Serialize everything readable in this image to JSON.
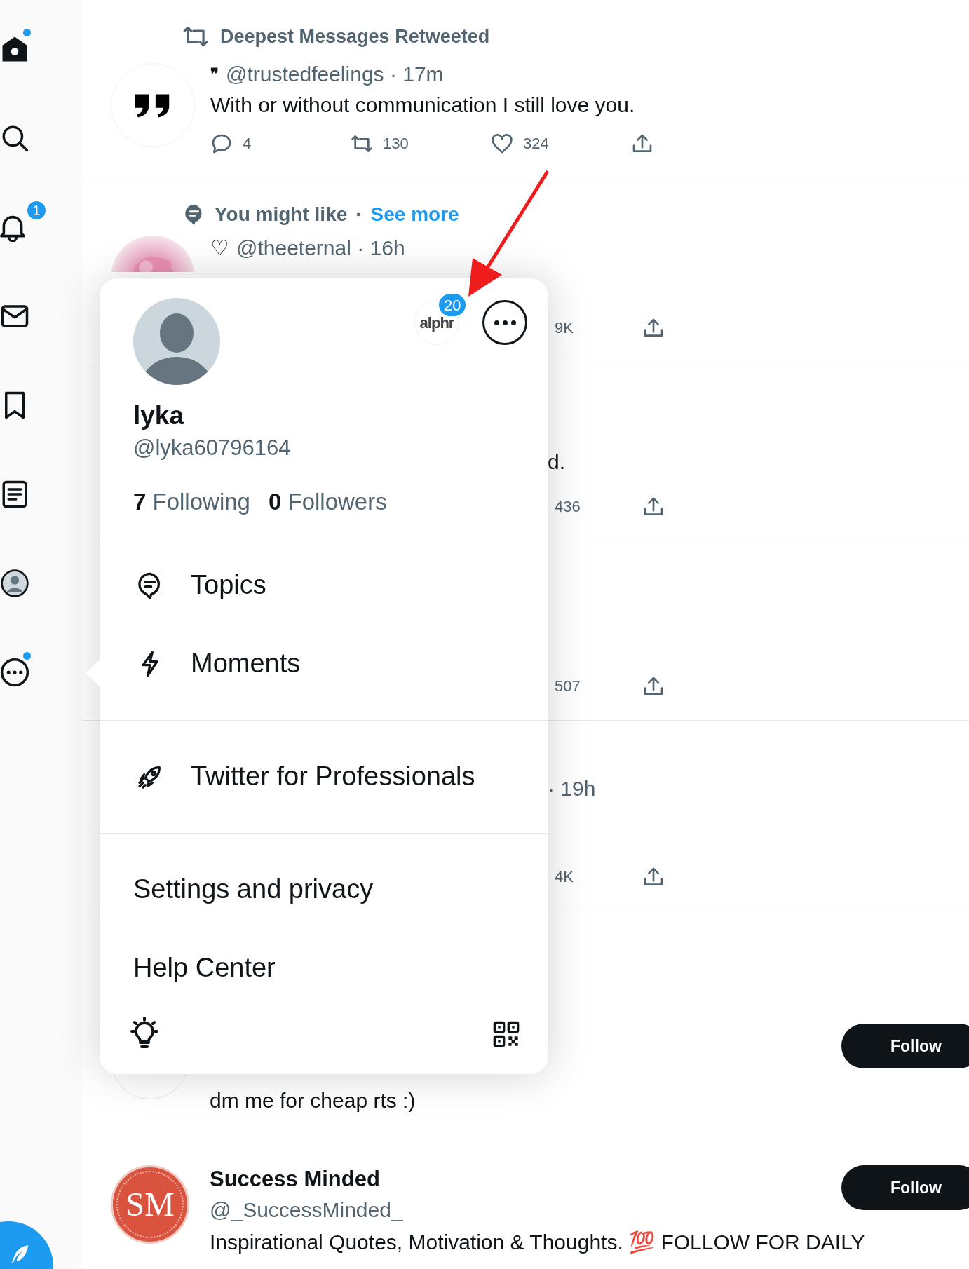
{
  "sidebar": {
    "items": [
      {
        "kind": "home",
        "unread_dot": true
      },
      {
        "kind": "search",
        "unread_dot": false
      },
      {
        "kind": "notifications",
        "unread_dot": false,
        "badge": "1"
      },
      {
        "kind": "messages",
        "unread_dot": false
      },
      {
        "kind": "bookmarks",
        "unread_dot": false
      },
      {
        "kind": "lists",
        "unread_dot": false
      },
      {
        "kind": "profile",
        "unread_dot": false
      },
      {
        "kind": "more",
        "unread_dot": true
      }
    ]
  },
  "feed": {
    "retweeted_tweet": {
      "context": "Deepest Messages Retweeted",
      "name_symbol": "❞",
      "handle": "@trustedfeelings · 17m",
      "text": "With or without communication I still love you.",
      "actions": [
        {
          "kind": "reply",
          "count": "4"
        },
        {
          "kind": "retweet",
          "count": "130"
        },
        {
          "kind": "like",
          "count": "324"
        },
        {
          "kind": "share"
        }
      ]
    },
    "suggested_tweet": {
      "context": "You might like",
      "separator": "·",
      "link": "See more",
      "name_symbol": "♡",
      "handle": "@theeternal · 16h",
      "count": "9K"
    },
    "covered_tweets": [
      {
        "text": "d.",
        "count": "436"
      },
      {
        "count": "507"
      },
      {
        "text": "· 19h",
        "count": "4K"
      }
    ],
    "accounts": [
      {
        "bio": "dm me for cheap rts :)",
        "follow": "Follow"
      },
      {
        "name": "Success Minded",
        "handle": "@_SuccessMinded_",
        "avatar": "SM",
        "bio": "Inspirational Quotes, Motivation & Thoughts. 💯 FOLLOW FOR DAILY",
        "follow": "Follow"
      }
    ]
  },
  "account_menu": {
    "name": "lyka",
    "handle": "@lyka60796164",
    "following_count": "7",
    "following_label": "Following",
    "followers_count": "0",
    "followers_label": "Followers",
    "other_account": {
      "logo_text": "alphr",
      "badge": "20"
    },
    "items": [
      {
        "kind": "topics",
        "label": "Topics"
      },
      {
        "kind": "moments",
        "label": "Moments"
      },
      {
        "kind": "divider"
      },
      {
        "kind": "professionals",
        "label": "Twitter for Professionals"
      },
      {
        "kind": "divider"
      },
      {
        "kind": "plain",
        "label": "Settings and privacy"
      },
      {
        "kind": "plain",
        "label": "Help Center"
      }
    ]
  },
  "annotation": {
    "kind": "arrow"
  },
  "compose_button": {
    "kind": "tweet"
  }
}
